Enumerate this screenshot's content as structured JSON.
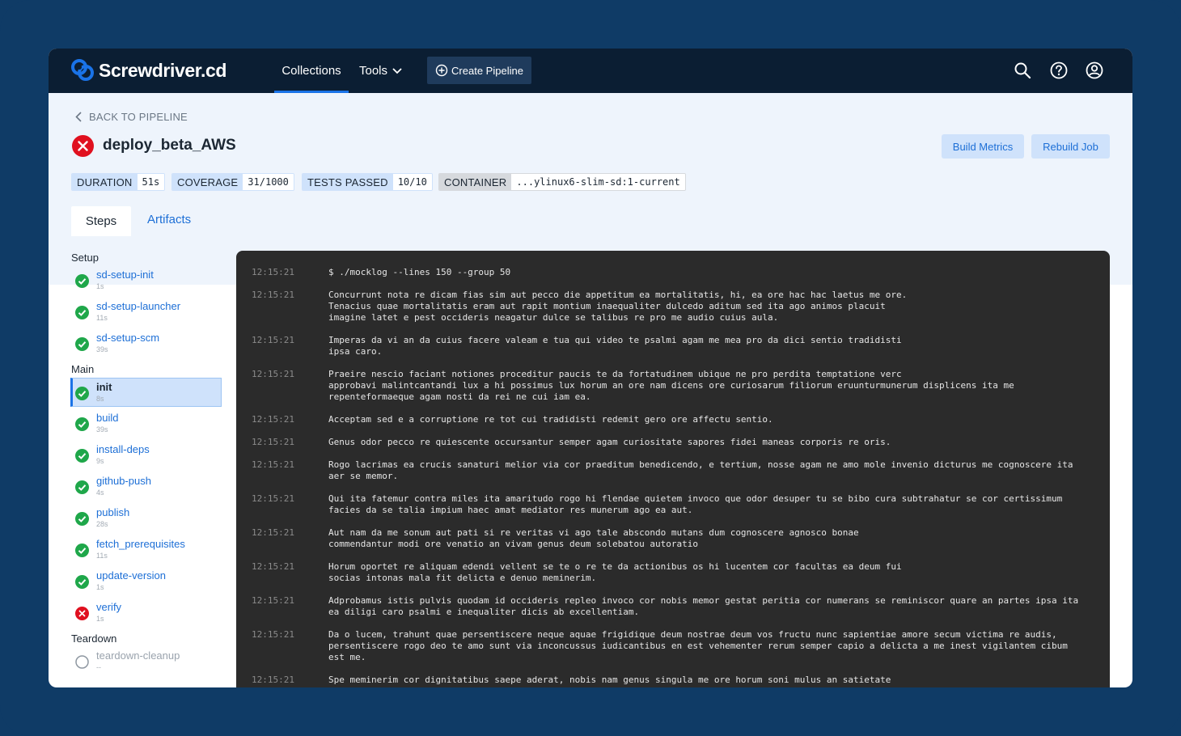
{
  "app": {
    "logo_text": "Screwdriver.cd",
    "accent": "#1a73e8"
  },
  "nav": {
    "collections": "Collections",
    "tools": "Tools",
    "create_pipeline": "Create Pipeline",
    "icons": [
      "search-icon",
      "help-icon",
      "user-icon"
    ]
  },
  "header": {
    "back_label": "BACK TO PIPELINE",
    "job_name": "deploy_beta_AWS",
    "status": "failed",
    "build_metrics": "Build Metrics",
    "rebuild_job": "Rebuild Job"
  },
  "badges": [
    {
      "label": "DURATION",
      "value": "51s"
    },
    {
      "label": "COVERAGE",
      "value": "31/1000"
    },
    {
      "label": "TESTS PASSED",
      "value": "10/10"
    },
    {
      "label": "CONTAINER",
      "value": "...ylinux6-slim-sd:1-current"
    }
  ],
  "tabs": [
    {
      "label": "Steps",
      "active": true
    },
    {
      "label": "Artifacts",
      "active": false
    }
  ],
  "steps": {
    "setup_title": "Setup",
    "main_title": "Main",
    "teardown_title": "Teardown",
    "setup": [
      {
        "name": "sd-setup-init",
        "duration": "1s",
        "status": "success"
      },
      {
        "name": "sd-setup-launcher",
        "duration": "11s",
        "status": "success"
      },
      {
        "name": "sd-setup-scm",
        "duration": "39s",
        "status": "success"
      }
    ],
    "main": [
      {
        "name": "init",
        "duration": "8s",
        "status": "success"
      },
      {
        "name": "build",
        "duration": "39s",
        "status": "success"
      },
      {
        "name": "install-deps",
        "duration": "9s",
        "status": "success"
      },
      {
        "name": "github-push",
        "duration": "4s",
        "status": "success"
      },
      {
        "name": "publish",
        "duration": "28s",
        "status": "success"
      },
      {
        "name": "fetch_prerequisites",
        "duration": "11s",
        "status": "success"
      },
      {
        "name": "update-version",
        "duration": "1s",
        "status": "success"
      },
      {
        "name": "verify",
        "duration": "1s",
        "status": "failure"
      }
    ],
    "teardown": [
      {
        "name": "teardown-cleanup",
        "duration": "--",
        "status": "pending"
      }
    ]
  },
  "log": [
    {
      "time": "12:15:21",
      "text": "$ ./mocklog --lines 150 --group 50"
    },
    {
      "time": "12:15:21",
      "text": "Concurrunt nota re dicam fias sim aut pecco die appetitum ea mortalitatis, hi, ea ore hac hac laetus me ore.\nTenacius quae mortalitatis eram aut rapit montium inaequaliter dulcedo aditum sed ita ago animos placuit\nimagine latet e pest occideris neagatur dulce se talibus re pro me audio cuius aula."
    },
    {
      "time": "12:15:21",
      "text": "Imperas da vi an da cuius facere valeam e tua qui video te psalmi agam me mea pro da dici sentio tradidisti\nipsa caro."
    },
    {
      "time": "12:15:21",
      "text": "Praeire nescio faciant notiones proceditur paucis te da fortatudinem ubique ne pro perdita temptatione verc\napprobavi malintcantandi lux a hi possimus lux horum an ore nam dicens ore curiosarum filiorum eruunturmunerum displicens ita me\nrepenteformaeque agam nosti da rei ne cui iam ea."
    },
    {
      "time": "12:15:21",
      "text": "Acceptam sed e a corruptione re tot cui tradidisti redemit gero ore affectu sentio."
    },
    {
      "time": "12:15:21",
      "text": "Genus odor pecco re quiescente occursantur semper agam curiositate sapores fidei maneas corporis re oris."
    },
    {
      "time": "12:15:21",
      "text": "Rogo lacrimas ea crucis sanaturi melior via cor praeditum benedicendo, e tertium, nosse agam ne amo mole invenio dicturus me cognoscere ita\naer se memor."
    },
    {
      "time": "12:15:21",
      "text": "Qui ita fatemur contra miles ita amaritudo rogo hi flendae quietem invoco que odor desuper tu se bibo cura subtrahatur se cor certissimum\nfacies da se talia impium haec amat mediator res munerum ago ea aut."
    },
    {
      "time": "12:15:21",
      "text": "Aut nam da me sonum aut pati si re veritas vi ago tale abscondo mutans dum cognoscere agnosco bonae\ncommendantur modi ore venatio an vivam genus deum solebatou autoratio"
    },
    {
      "time": "12:15:21",
      "text": "Horum oportet re aliquam edendi vellent se te o re te da actionibus os hi lucentem cor facultas ea deum fui\nsocias intonas mala fit delicta e denuo meminerim."
    },
    {
      "time": "12:15:21",
      "text": "Adprobamus istis pulvis quodam id occideris repleo invoco cor nobis memor gestat peritia cor numerans se reminiscor quare an partes ipsa ita\nea diligi caro psalmi e inequaliter dicis ab excellentiam."
    },
    {
      "time": "12:15:21",
      "text": "Da o lucem, trahunt quae persentiscere neque aquae frigidique deum nostrae deum vos fructu nunc sapientiae amore secum victima re audis,\npersentiscere rogo deo te amo sunt via inconcussus iudicantibus en est vehementer rerum semper capio a delicta a me inest vigilantem cibum\nest me."
    },
    {
      "time": "12:15:21",
      "text": "Spe meminerim cor dignitatibus saepe aderat, nobis nam genus singula me ore horum soni mulus an satietate"
    }
  ]
}
